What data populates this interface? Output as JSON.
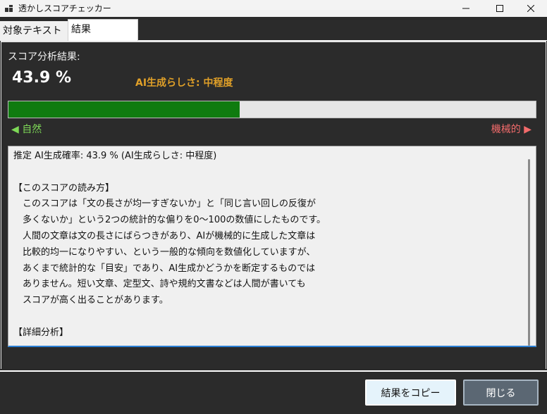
{
  "window": {
    "title": "透かしスコアチェッカー",
    "icon": "app-window-icon",
    "controls": [
      "minimize-icon",
      "maximize-icon",
      "close-icon"
    ]
  },
  "tabs": [
    {
      "label": "対象テキスト",
      "active": false
    },
    {
      "label": "結果",
      "active": true
    }
  ],
  "result": {
    "heading": "スコア分析結果:",
    "score_text": "43.9 %",
    "score_value": 43.9,
    "likeness": "AI生成らしさ: 中程度",
    "natural_label": "◀ 自然",
    "machine_label": "機械的 ▶",
    "colors": {
      "bar_fill": "#0f7b0f",
      "likeness": "#e0a028",
      "natural": "#7ed957",
      "machine": "#f26b6b"
    }
  },
  "textbox": {
    "lines": [
      "推定 AI生成確率: 43.9 % (AI生成らしさ: 中程度)",
      "",
      "【このスコアの読み方】",
      "　このスコアは「文の長さが均一すぎないか」と「同じ言い回しの反復が",
      "　多くないか」という2つの統計的な偏りを0〜100の数値にしたものです。",
      "　人間の文章は文の長さにばらつきがあり、AIが機械的に生成した文章は",
      "　比較的均一になりやすい、という一般的な傾向を数値化していますが、",
      "　あくまで統計的な「目安」であり、AI生成かどうかを断定するものでは",
      "　ありません。短い文章、定型文、詩や規約文書などは人間が書いても",
      "　スコアが高く出ることがあります。",
      "",
      "【詳細分析】"
    ]
  },
  "buttons": {
    "copy": "結果をコピー",
    "close": "閉じる"
  }
}
